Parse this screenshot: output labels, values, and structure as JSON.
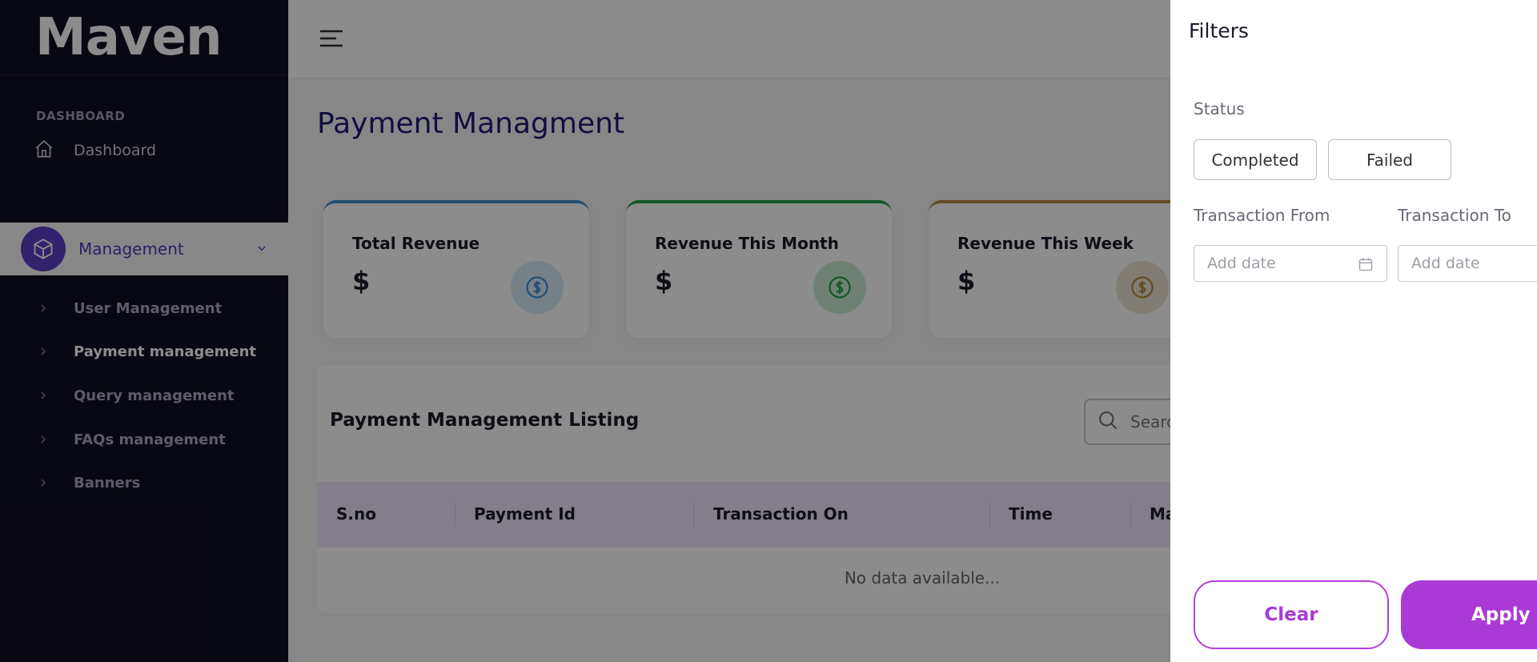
{
  "brand": {
    "name": "Maven"
  },
  "sidebar": {
    "section_label": "DASHBOARD",
    "dashboard_label": "Dashboard",
    "management_label": "Management",
    "items": [
      {
        "label": "User Management"
      },
      {
        "label": "Payment management"
      },
      {
        "label": "Query management"
      },
      {
        "label": "FAQs management"
      },
      {
        "label": "Banners"
      }
    ]
  },
  "page": {
    "title": "Payment Managment"
  },
  "cards": [
    {
      "title": "Total Revenue",
      "value": "$",
      "accent": "#3b91d6",
      "icon": "dollar-icon"
    },
    {
      "title": "Revenue This Month",
      "value": "$",
      "accent": "#1fa24a",
      "icon": "dollar-icon"
    },
    {
      "title": "Revenue This Week",
      "value": "$",
      "accent": "#b58a3c",
      "icon": "dollar-icon"
    }
  ],
  "listing": {
    "title": "Payment Management Listing",
    "search_placeholder": "Search",
    "columns": [
      "S.no",
      "Payment Id",
      "Transaction On",
      "Time",
      "Ma"
    ],
    "empty_text": "No data available..."
  },
  "filters": {
    "title": "Filters",
    "status_label": "Status",
    "status_options": [
      "Completed",
      "Failed"
    ],
    "from_label": "Transaction From",
    "to_label": "Transaction To",
    "date_placeholder": "Add date",
    "clear_label": "Clear",
    "apply_label": "Apply",
    "accent": "#a93ad6"
  }
}
